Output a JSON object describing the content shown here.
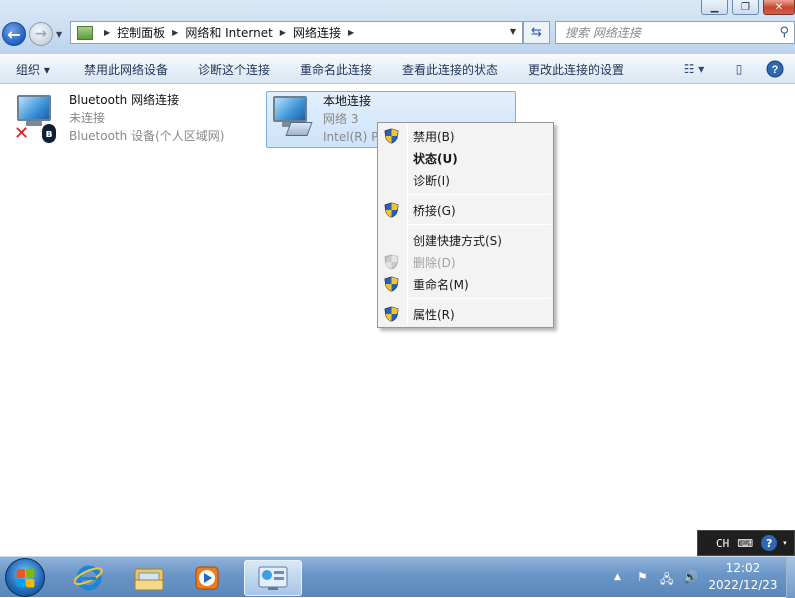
{
  "window": {
    "controls": {
      "minimize": "▁",
      "maximize": "❐",
      "close": "✕"
    }
  },
  "nav": {
    "breadcrumb": [
      "控制面板",
      "网络和 Internet",
      "网络连接"
    ],
    "search_placeholder": "搜索 网络连接"
  },
  "toolbar": {
    "organize": "组织 ▾",
    "disable": "禁用此网络设备",
    "diagnose": "诊断这个连接",
    "rename": "重命名此连接",
    "view_status": "查看此连接的状态",
    "change_settings": "更改此连接的设置"
  },
  "connections": [
    {
      "name": "Bluetooth 网络连接",
      "status": "未连接",
      "device": "Bluetooth 设备(个人区域网)"
    },
    {
      "name": "本地连接",
      "status": "网络  3",
      "device": "Intel(R) PRO/1000 MT Network Connection"
    }
  ],
  "context_menu": {
    "items": [
      {
        "label": "禁用(B)",
        "shield": true,
        "disabled": false,
        "bold": false
      },
      {
        "label": "状态(U)",
        "shield": false,
        "disabled": false,
        "bold": true
      },
      {
        "label": "诊断(I)",
        "shield": false,
        "disabled": false,
        "bold": false
      },
      {
        "label": "桥接(G)",
        "shield": true,
        "disabled": false,
        "bold": false
      },
      {
        "label": "创建快捷方式(S)",
        "shield": false,
        "disabled": false,
        "bold": false
      },
      {
        "label": "删除(D)",
        "shield": true,
        "disabled": true,
        "bold": false
      },
      {
        "label": "重命名(M)",
        "shield": true,
        "disabled": false,
        "bold": false
      },
      {
        "label": "属性(R)",
        "shield": true,
        "disabled": false,
        "bold": false
      }
    ]
  },
  "ime": {
    "lang": "CH"
  },
  "clock": {
    "time": "12:02",
    "date": "2022/12/23"
  },
  "colors": {
    "accent": "#3c93d8",
    "selection": "#cde3fa",
    "taskbar": "#6a95c6"
  }
}
